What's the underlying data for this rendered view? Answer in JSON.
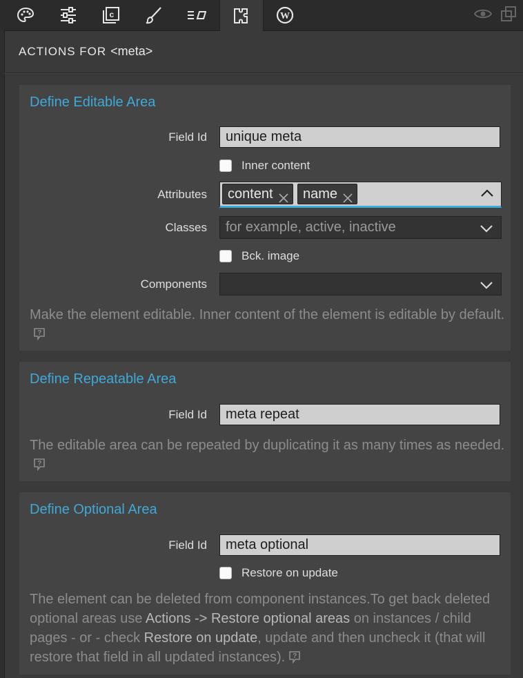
{
  "toolbar": {
    "tabs": [
      {
        "icon": "palette-icon"
      },
      {
        "icon": "sliders-icon"
      },
      {
        "icon": "component-icon"
      },
      {
        "icon": "brush-icon"
      },
      {
        "icon": "text-format-icon"
      },
      {
        "icon": "puzzle-icon",
        "active": true
      },
      {
        "icon": "wordpress-icon"
      }
    ],
    "right_icons": [
      "eye-icon",
      "duplicate-icon"
    ]
  },
  "panel": {
    "heading": "ACTIONS FOR",
    "element_tag": "<meta>"
  },
  "editable": {
    "title": "Define Editable Area",
    "field_id_label": "Field Id",
    "field_id_value": "unique meta",
    "inner_content_label": "Inner content",
    "attributes_label": "Attributes",
    "attributes": [
      "content",
      "name"
    ],
    "classes_label": "Classes",
    "classes_placeholder": "for example, active, inactive",
    "bck_image_label": "Bck. image",
    "components_label": "Components",
    "components_value": "",
    "help": "Make the element editable. Inner content of the element is editable by default."
  },
  "repeatable": {
    "title": "Define Repeatable Area",
    "field_id_label": "Field Id",
    "field_id_value": "meta repeat",
    "help": "The editable area can be repeated by duplicating it as many times as needed."
  },
  "optional": {
    "title": "Define Optional Area",
    "field_id_label": "Field Id",
    "field_id_value": "meta optional",
    "restore_label": "Restore on update",
    "help_1": "The element can be deleted from component instances.To get back deleted optional areas use ",
    "help_hl_1": "Actions -> Restore optional areas",
    "help_2": " on instances / child pages - or - check ",
    "help_hl_2": "Restore on update",
    "help_3": ", update and then uncheck it (that will restore that field in all updated instances)."
  },
  "colors": {
    "accent": "#3fa9d8",
    "panel_bg": "#3a3a3a",
    "section_bg": "#444444",
    "toolbar_bg": "#2b2b2b"
  }
}
